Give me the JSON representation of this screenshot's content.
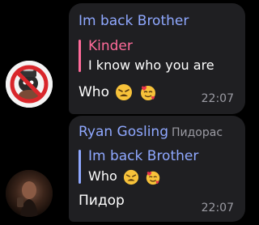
{
  "messages": [
    {
      "sender": "Im back Brother",
      "reply": {
        "name": "Kinder",
        "text": "I know who you are"
      },
      "text": "Who",
      "emojis": [
        "weary-face",
        "smiling-face-with-hearts"
      ],
      "time": "22:07"
    },
    {
      "sender": "Ryan Gosling",
      "rank": "Пидорас",
      "reply": {
        "name": "Im back Brother",
        "text": "Who"
      },
      "reply_emojis": [
        "weary-face",
        "smiling-face-with-hearts"
      ],
      "text": "Пидор",
      "time": "22:07"
    }
  ],
  "colors": {
    "background": "#000000",
    "bubble": "#1f1f22",
    "sender": "#8fa8ff",
    "reply_accent_1": "#ff6b9a",
    "reply_accent_2": "#8fa8ff",
    "time": "#9b9ba3"
  }
}
